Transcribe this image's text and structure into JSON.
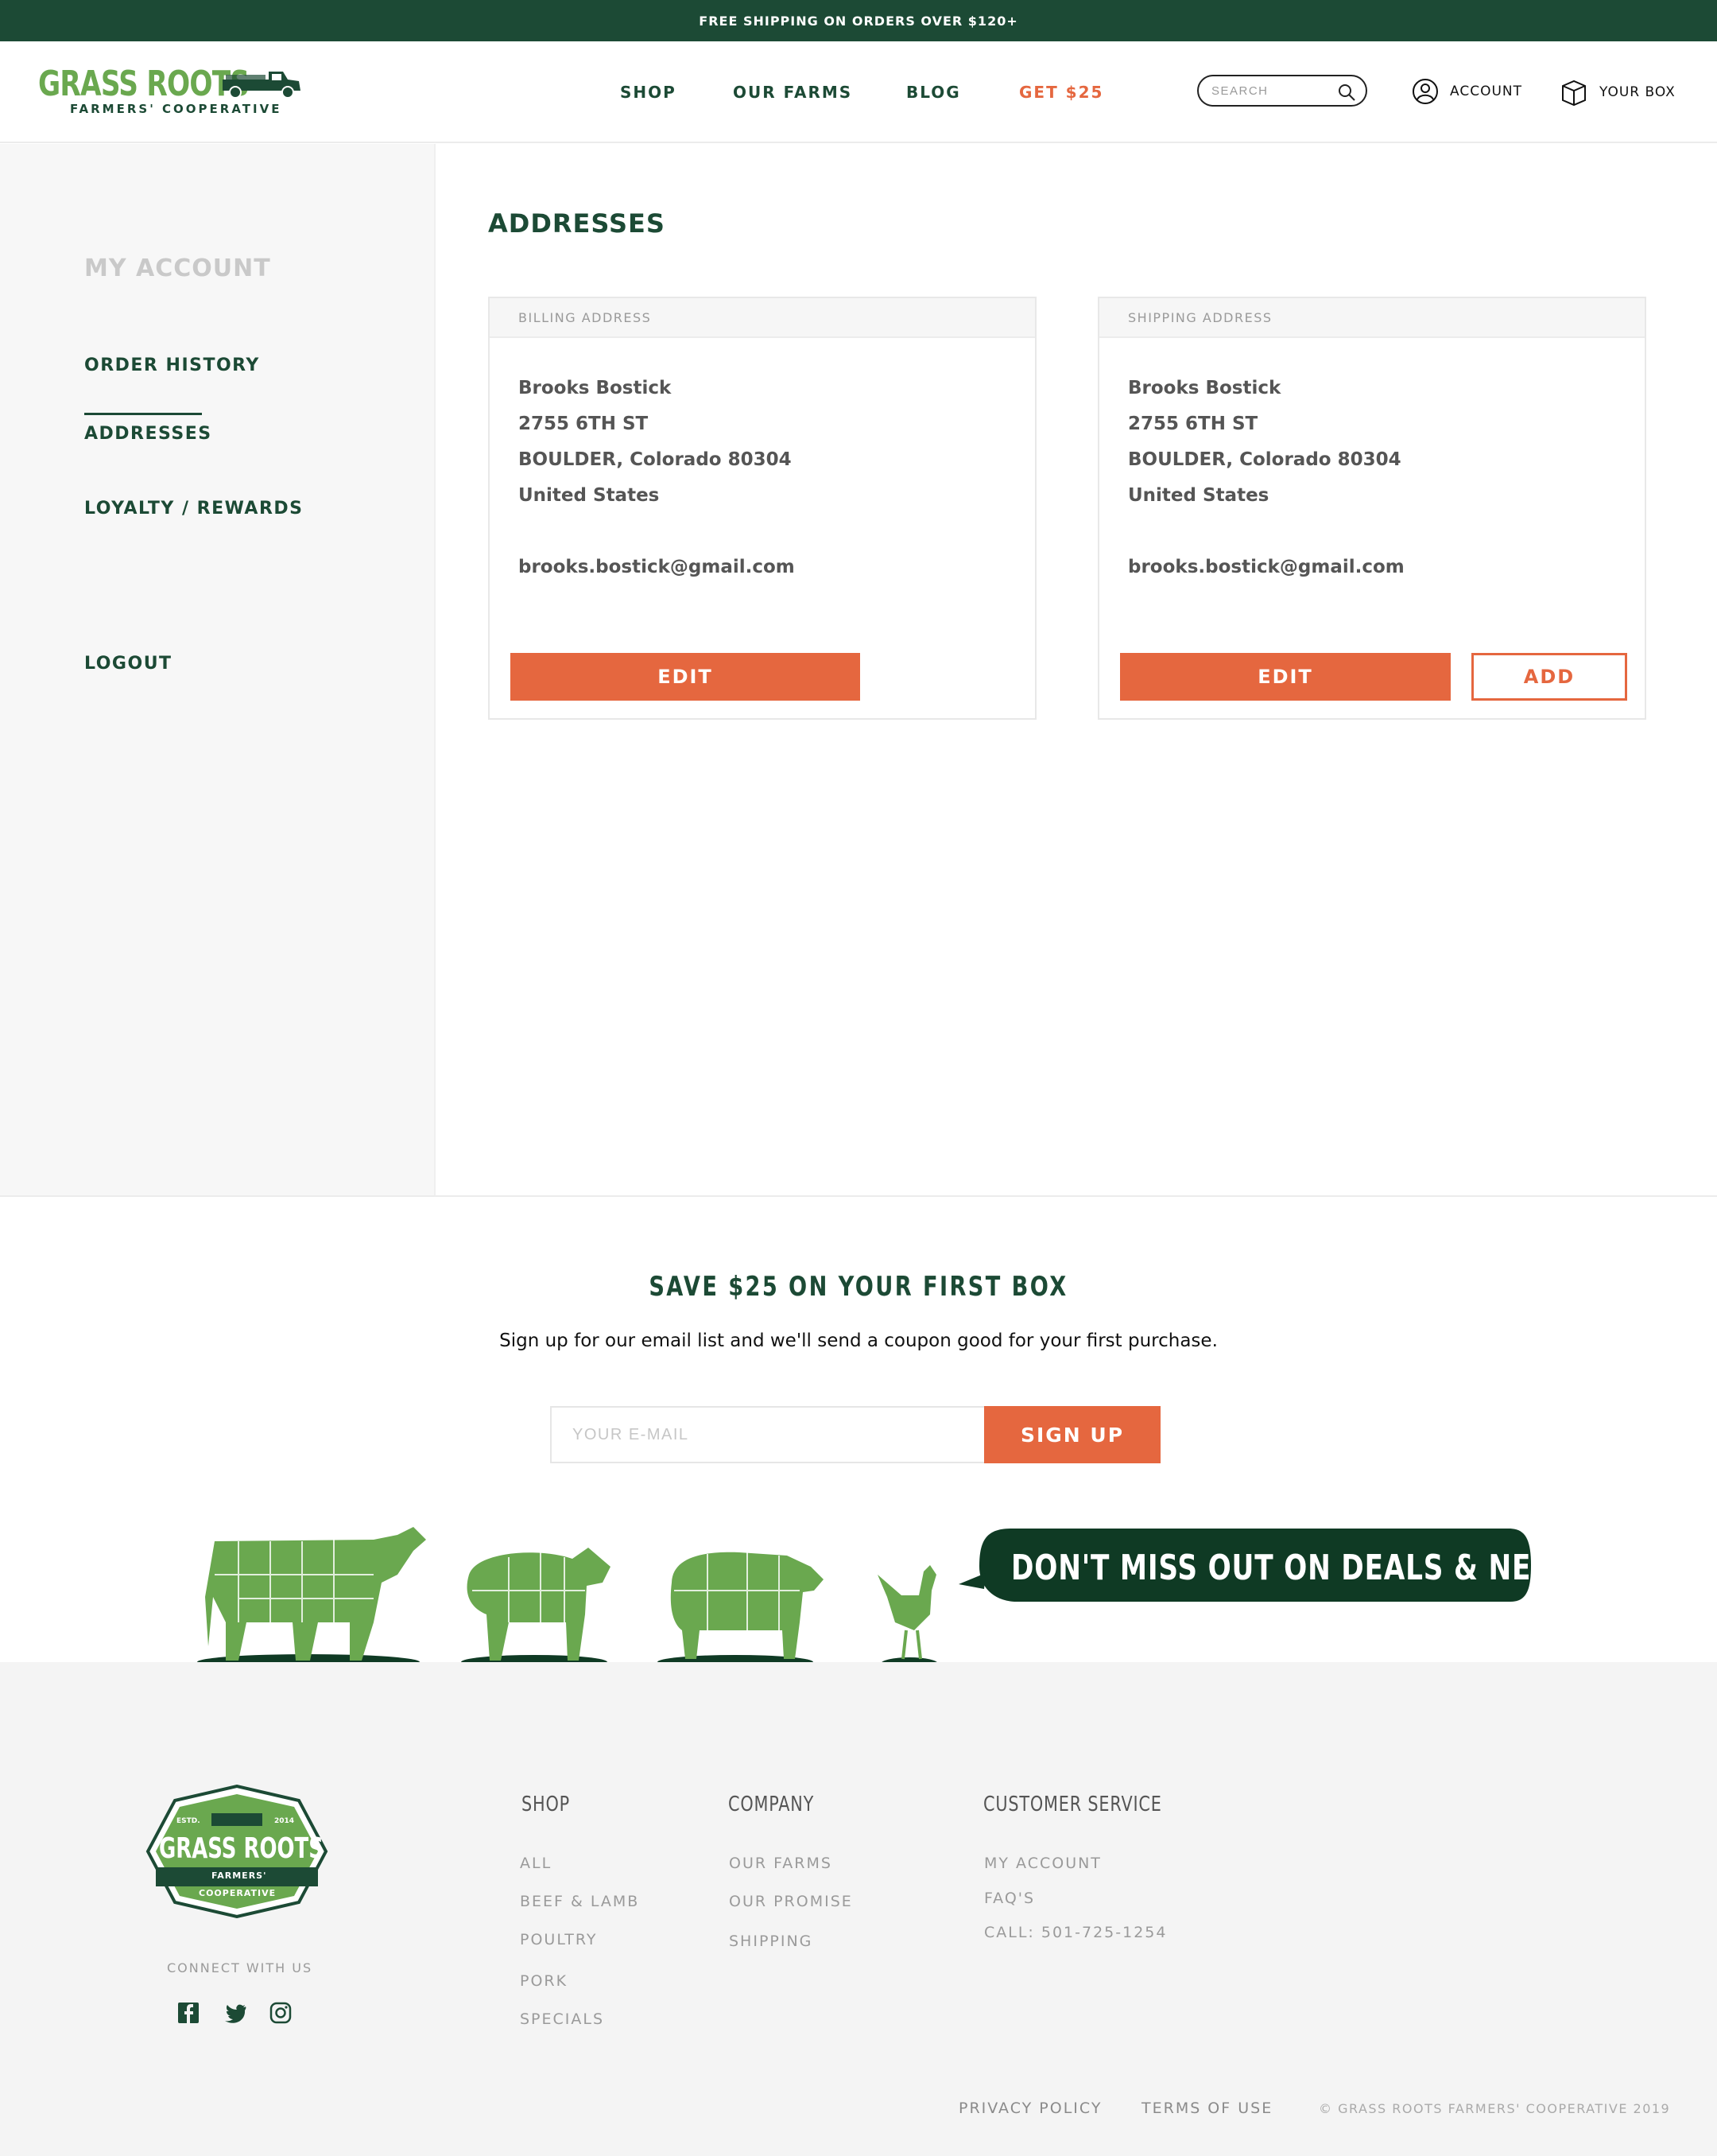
{
  "promo": {
    "text": "FREE SHIPPING ON ORDERS OVER $120+"
  },
  "brand": {
    "name": "GRASS ROOTS",
    "tagline": "FARMERS' COOPERATIVE"
  },
  "nav": {
    "shop": "SHOP",
    "farms": "OUR FARMS",
    "blog": "BLOG",
    "promo": "GET $25"
  },
  "search": {
    "placeholder": "SEARCH"
  },
  "header": {
    "account": "ACCOUNT",
    "box": "YOUR BOX"
  },
  "sidebar": {
    "title": "MY ACCOUNT",
    "items": [
      {
        "label": "ORDER HISTORY"
      },
      {
        "label": "ADDRESSES"
      },
      {
        "label": "LOYALTY / REWARDS"
      },
      {
        "label": "LOGOUT"
      }
    ]
  },
  "main": {
    "title": "ADDRESSES",
    "billing": {
      "heading": "BILLING ADDRESS",
      "name": "Brooks Bostick",
      "street": "2755 6TH ST",
      "city": "BOULDER, Colorado 80304",
      "country": "United States",
      "email": "brooks.bostick@gmail.com",
      "edit_label": "EDIT"
    },
    "shipping": {
      "heading": "SHIPPING ADDRESS",
      "name": "Brooks Bostick",
      "street": "2755 6TH ST",
      "city": "BOULDER, Colorado 80304",
      "country": "United States",
      "email": "brooks.bostick@gmail.com",
      "edit_label": "EDIT",
      "add_label": "ADD"
    }
  },
  "newsletter": {
    "title": "SAVE $25 ON YOUR FIRST BOX",
    "subtitle": "Sign up for our email list and we'll send a coupon good for your first purchase.",
    "placeholder": "YOUR E-MAIL",
    "button": "SIGN UP",
    "bubble": "DON'T MISS OUT ON DEALS & NEWS!"
  },
  "footer": {
    "badge_estd": "ESTD.",
    "badge_year": "2014",
    "badge_name": "GRASS ROOTS",
    "badge_sub1": "FARMERS'",
    "badge_sub2": "COOPERATIVE",
    "connect": "CONNECT WITH US",
    "social": [
      "facebook-icon",
      "twitter-icon",
      "instagram-icon"
    ],
    "shop": {
      "heading": "SHOP",
      "links": [
        "ALL",
        "BEEF & LAMB",
        "POULTRY",
        "PORK",
        "SPECIALS"
      ]
    },
    "company": {
      "heading": "COMPANY",
      "links": [
        "OUR FARMS",
        "OUR PROMISE",
        "SHIPPING"
      ]
    },
    "service": {
      "heading": "CUSTOMER SERVICE",
      "links": [
        "MY ACCOUNT",
        "FAQ'S",
        "CALL: 501-725-1254"
      ]
    },
    "privacy": "PRIVACY POLICY",
    "terms": "TERMS OF USE",
    "copyright": "© GRASS ROOTS FARMERS' COOPERATIVE 2019"
  },
  "colors": {
    "brand_green": "#1c4a35",
    "leaf_green": "#6aa84f",
    "accent_orange": "#e5673f"
  }
}
